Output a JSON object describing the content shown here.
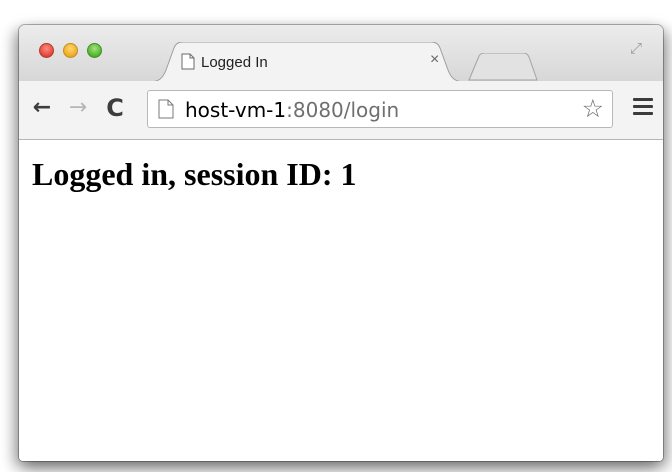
{
  "tab": {
    "title": "Logged In",
    "close_icon": "×"
  },
  "toolbar": {
    "back_icon": "←",
    "forward_icon": "→",
    "reload_icon": "C",
    "url_host": "host-vm-1",
    "url_rest": ":8080/login",
    "bookmark_icon": "☆"
  },
  "page": {
    "heading": "Logged in, session ID: 1"
  },
  "window": {
    "fullscreen_icon": "⤢"
  },
  "colors": {
    "close": "#e0443a",
    "minimize": "#eeaa20",
    "maximize": "#4fb22f"
  }
}
